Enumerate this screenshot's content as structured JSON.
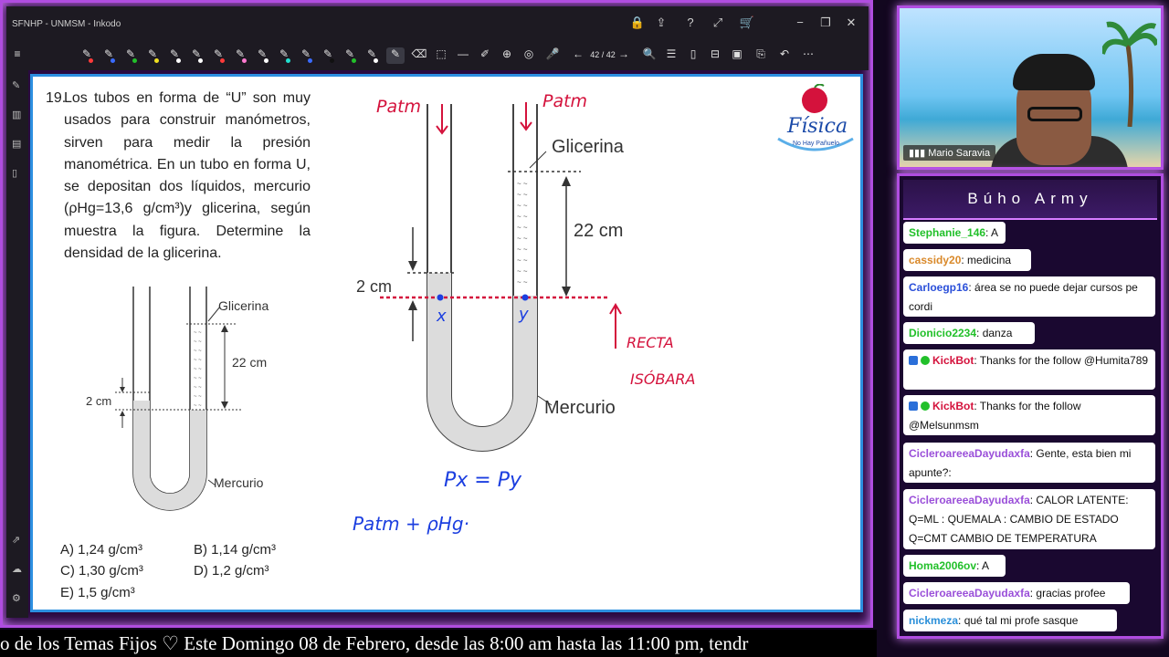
{
  "window": {
    "title": "SFNHP - UNMSM - Inkodo",
    "page_indicator": "42 / 42"
  },
  "colors": {
    "frame_accent": "#b04de0",
    "canvas_border": "#2c8fe0",
    "red_ink": "#d4123c",
    "blue_ink": "#1c3fe0"
  },
  "question": {
    "number": "19.",
    "text": "Los tubos en forma de “U” son muy usados para construir manómetros, sirven para medir la presión manométrica. En un tubo en forma U, se depositan dos líquidos, mercurio (ρHg=13,6 g/cm³)y glicerina, según muestra la figura. Determine la densidad de la glicerina."
  },
  "answers": [
    {
      "label": "A) 1,24 g/cm³"
    },
    {
      "label": "B) 1,14 g/cm³"
    },
    {
      "label": "C) 1,30 g/cm³"
    },
    {
      "label": "D) 1,2 g/cm³"
    },
    {
      "label": "E) 1,5 g/cm³"
    }
  ],
  "small_diagram": {
    "glicerina": "Glicerina",
    "h22": "22 cm",
    "h2": "2 cm",
    "mercurio": "Mercurio"
  },
  "big_diagram": {
    "patm_left": "Patm",
    "patm_right": "Patm",
    "glicerina": "Glicerina",
    "h22": "22 cm",
    "h2": "2 cm",
    "mercurio": "Mercurio",
    "point_x": "x",
    "point_y": "y",
    "recta": "RECTA",
    "isobara": "ISÓBARA",
    "eq1": "Px = Py",
    "eq2": "Patm + ρHg·"
  },
  "logo": {
    "brand": "Física",
    "slogan": "No Hay Pañuelo"
  },
  "webcam": {
    "name": "Mario Saravia"
  },
  "chat": {
    "title": "Búho Army",
    "messages": [
      {
        "user": "Stephanie_146",
        "color": "#22c02a",
        "text": ": A"
      },
      {
        "user": "cassidy20",
        "color": "#d9892a",
        "text": ": medicina"
      },
      {
        "user": "Carloegp16",
        "color": "#2a4fd9",
        "text": ": área se no puede dejar cursos pe cordi"
      },
      {
        "user": "Dionicio2234",
        "color": "#22c02a",
        "text": ": danza"
      },
      {
        "user": "KickBot",
        "color": "#d4123c",
        "text": ": Thanks for the follow @Humita789"
      },
      {
        "user": "KickBot",
        "color": "#d4123c",
        "text": ": Thanks for the follow @Melsunmsm"
      },
      {
        "user": "CicleroareeaDayudaxfa",
        "color": "#9a4fd9",
        "text": ": Gente, esta bien mi apunte?:"
      },
      {
        "user": "CicleroareeaDayudaxfa",
        "color": "#9a4fd9",
        "text": ": CALOR LATENTE: Q=ML : QUEMALA : CAMBIO DE ESTADO Q=CMT CAMBIO DE TEMPERATURA"
      },
      {
        "user": "Homa2006ov",
        "color": "#22c02a",
        "text": ": A"
      },
      {
        "user": "CicleroareeaDayudaxfa",
        "color": "#9a4fd9",
        "text": ": gracias profee"
      },
      {
        "user": "nickmeza",
        "color": "#2a8fd9",
        "text": ": qué tal mi profe sasque"
      }
    ]
  },
  "ticker": {
    "text": "o de los Temas Fijos ♡  Este Domingo 08 de Febrero, desde las 8:00 am hasta las 11:00 pm, tendr"
  }
}
